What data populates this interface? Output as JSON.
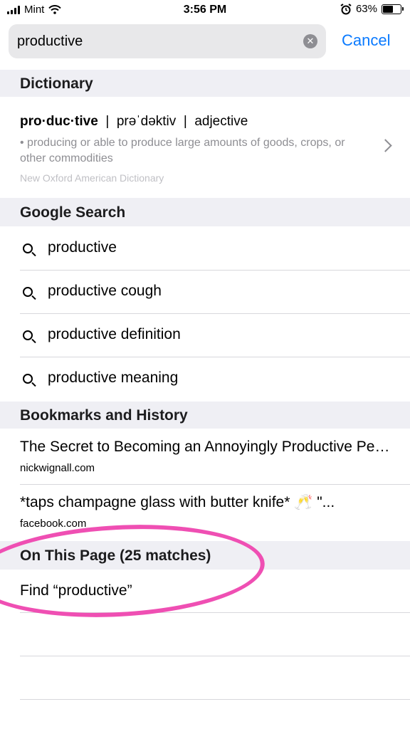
{
  "status": {
    "carrier": "Mint",
    "time": "3:56 PM",
    "battery": "63%",
    "battery_level": 0.63
  },
  "search": {
    "value": "productive",
    "cancel_label": "Cancel"
  },
  "sections": {
    "dictionary": "Dictionary",
    "google": "Google Search",
    "bookmarks": "Bookmarks and History",
    "onpage": "On This Page (25 matches)"
  },
  "dictionary_entry": {
    "headword": "pro·duc·tive",
    "separator": "|",
    "pronunciation": "prəˈdəktiv",
    "part_of_speech": "adjective",
    "definition": "• producing or able to produce large amounts of goods, crops, or other commodities",
    "source": "New Oxford American Dictionary"
  },
  "google_suggestions": [
    "productive",
    "productive cough",
    "productive definition",
    "productive meaning"
  ],
  "bookmarks": [
    {
      "title": "The Secret to Becoming an Annoyingly Productive Person",
      "url": "nickwignall.com"
    },
    {
      "title": "*taps champagne glass with butter knife* 🥂 \"...",
      "url": "facebook.com"
    }
  ],
  "find_label": "Find “productive”",
  "colors": {
    "accent": "#0a7aff",
    "highlight": "#ef4fb3",
    "section_bg": "#efeff4"
  }
}
